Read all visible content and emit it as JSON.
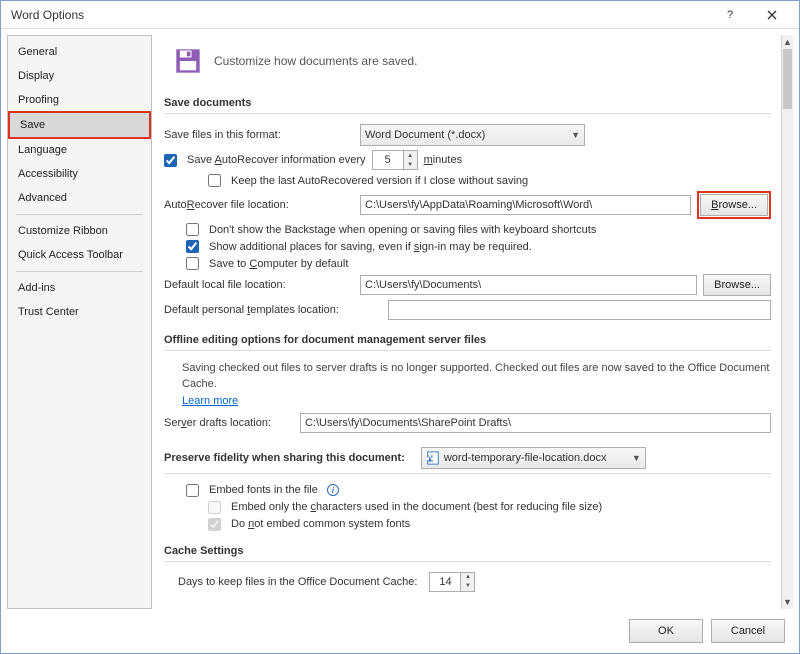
{
  "window": {
    "title": "Word Options",
    "ok": "OK",
    "cancel": "Cancel"
  },
  "sidebar": {
    "items": [
      "General",
      "Display",
      "Proofing",
      "Save",
      "Language",
      "Accessibility",
      "Advanced",
      "Customize Ribbon",
      "Quick Access Toolbar",
      "Add-ins",
      "Trust Center"
    ]
  },
  "header": "Customize how documents are saved.",
  "sections": {
    "save_documents": "Save documents",
    "offline": "Offline editing options for document management server files",
    "fidelity": "Preserve fidelity when sharing this document:",
    "cache": "Cache Settings"
  },
  "labels": {
    "save_format": "Save files in this format:",
    "format_value": "Word Document (*.docx)",
    "autorecover_chk": "Save AutoRecover information every",
    "autorecover_minutes": "5",
    "minutes": "minutes",
    "keep_last": "Keep the last AutoRecovered version if I close without saving",
    "ar_location": "AutoRecover file location:",
    "ar_path": "C:\\Users\\fy\\AppData\\Roaming\\Microsoft\\Word\\",
    "browse": "Browse...",
    "dont_show_backstage": "Don't show the Backstage when opening or saving files with keyboard shortcuts",
    "show_additional": "Show additional places for saving, even if sign-in may be required.",
    "save_to_computer": "Save to Computer by default",
    "default_local": "Default local file location:",
    "default_local_path": "C:\\Users\\fy\\Documents\\",
    "default_templates": "Default personal templates location:",
    "default_templates_path": "",
    "offline_body": "Saving checked out files to server drafts is no longer supported. Checked out files are now saved to the Office Document Cache.",
    "learn_more": "Learn more",
    "server_drafts": "Server drafts location:",
    "server_drafts_path": "C:\\Users\\fy\\Documents\\SharePoint Drafts\\",
    "fidelity_doc": "word-temporary-file-location.docx",
    "embed_fonts": "Embed fonts in the file",
    "embed_only": "Embed only the characters used in the document (best for reducing file size)",
    "no_common": "Do not embed common system fonts",
    "cache_days_label": "Days to keep files in the Office Document Cache:",
    "cache_days": "14"
  }
}
